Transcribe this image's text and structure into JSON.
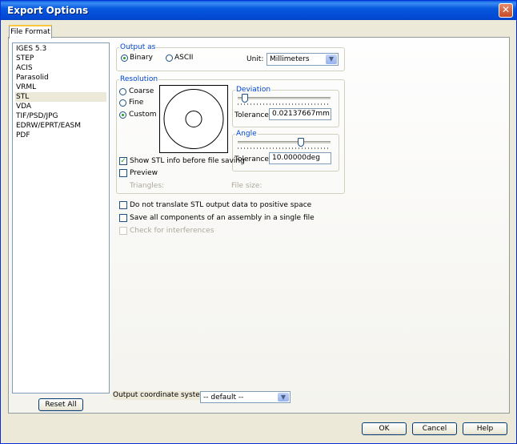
{
  "window": {
    "title": "Export Options"
  },
  "tab": {
    "label": "File Format"
  },
  "formats": [
    "IGES 5.3",
    "STEP",
    "ACIS",
    "Parasolid",
    "VRML",
    "STL",
    "VDA",
    "TIF/PSD/JPG",
    "EDRW/EPRT/EASM",
    "PDF"
  ],
  "selected_format": "STL",
  "output_as": {
    "legend": "Output as",
    "binary_label": "Binary",
    "ascii_label": "ASCII",
    "selected": "Binary",
    "unit_label": "Unit:",
    "unit_value": "Millimeters"
  },
  "resolution": {
    "legend": "Resolution",
    "coarse_label": "Coarse",
    "fine_label": "Fine",
    "custom_label": "Custom",
    "selected": "Custom",
    "deviation": {
      "legend": "Deviation",
      "tolerance_label": "Tolerance:",
      "tolerance_value": "0.02137667mm",
      "slider_fraction": 0.07
    },
    "angle": {
      "legend": "Angle",
      "tolerance_label": "Tolerance:",
      "tolerance_value": "10.00000deg",
      "slider_fraction": 0.67
    },
    "show_info_label": "Show STL info before file saving",
    "show_info_checked": true,
    "preview_label": "Preview",
    "preview_checked": false,
    "triangles_label": "Triangles:",
    "file_size_label": "File size:"
  },
  "options": {
    "no_translate_label": "Do not translate STL output data to positive space",
    "save_all_label": "Save all components of an assembly in a single file",
    "interferences_label": "Check for interferences"
  },
  "coordinate_system": {
    "label": "Output coordinate system:",
    "value": "-- default --"
  },
  "buttons": {
    "reset_all": "Reset All",
    "ok": "OK",
    "cancel": "Cancel",
    "help": "Help"
  },
  "colors": {
    "titlebar": "#0758de",
    "group_legend": "#0046d5",
    "face": "#ece9d8",
    "check_mark": "#21a121"
  }
}
